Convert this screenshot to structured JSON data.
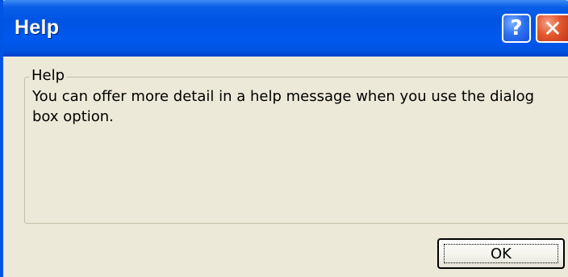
{
  "dialog": {
    "title": "Help",
    "help_button_glyph": "?",
    "close_button_glyph": "✕",
    "group_label": "Help",
    "message": "You can offer more detail in a help message when you use the dialog box option.",
    "ok_label": "OK"
  },
  "icons": {
    "help": "question-mark-icon",
    "close": "close-icon"
  },
  "colors": {
    "titlebar": "#0054e3",
    "dialog_background": "#ece9d8",
    "close_button": "#e4582e",
    "help_button": "#2f73f0"
  }
}
